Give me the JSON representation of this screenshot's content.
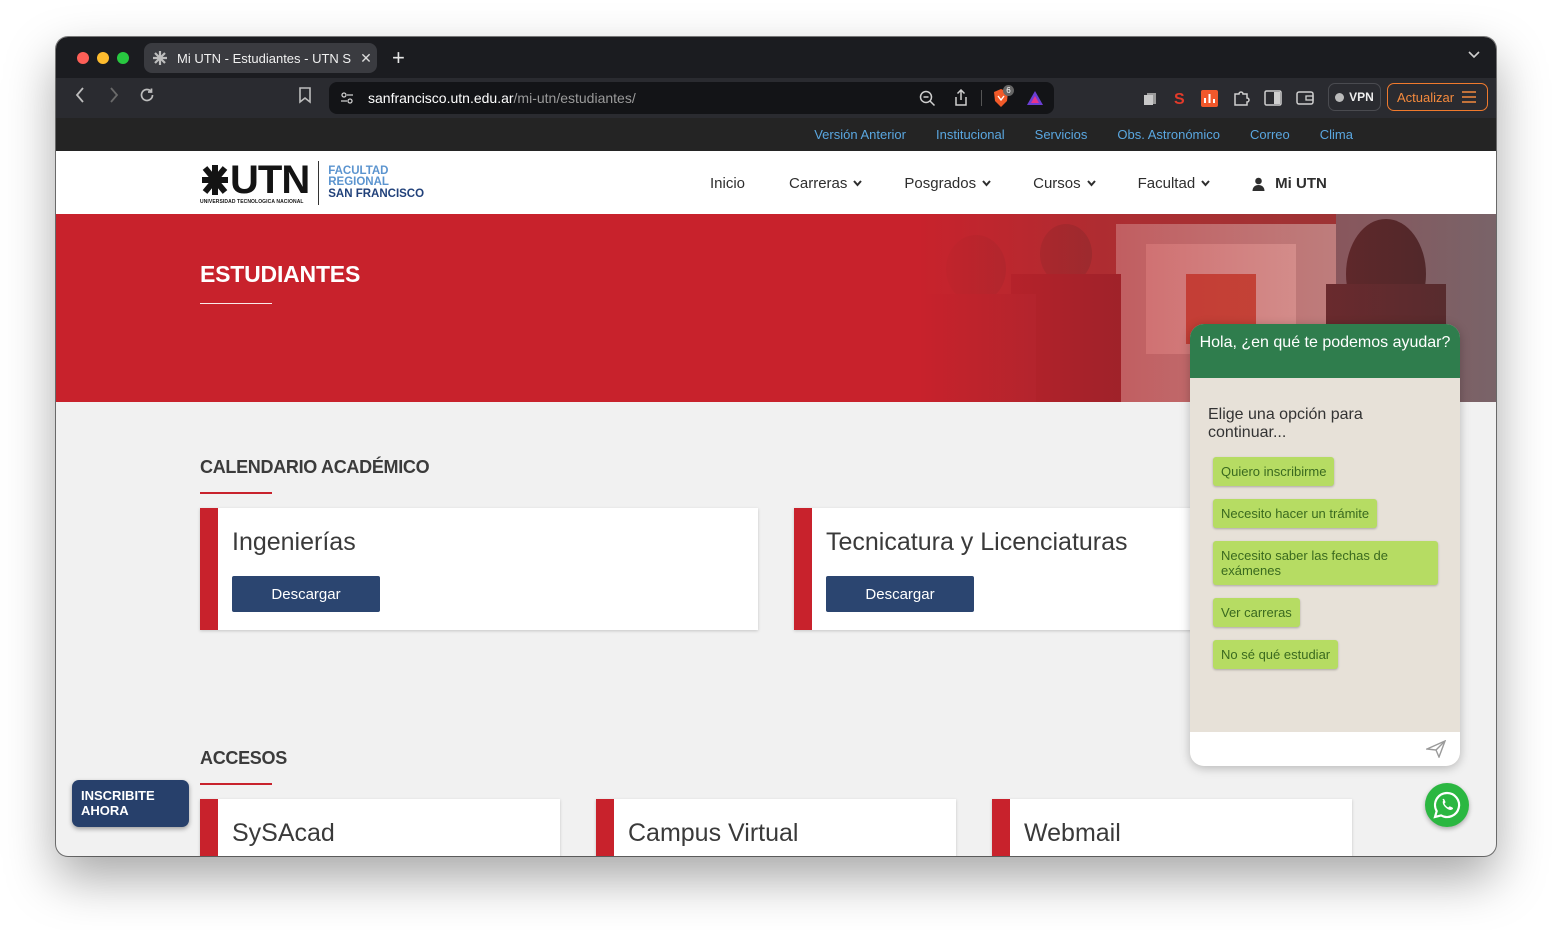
{
  "browser": {
    "tab_title": "Mi UTN - Estudiantes - UTN S",
    "tab_close": "✕",
    "new_tab": "+",
    "tab_menu": "⌄",
    "url_domain": "sanfrancisco.utn.edu.ar",
    "url_path": "/mi-utn/estudiantes/",
    "shield_badge": "6",
    "vpn_label": "VPN",
    "update_label": "Actualizar"
  },
  "topbar": {
    "links": [
      "Versión Anterior",
      "Institucional",
      "Servicios",
      "Obs. Astronómico",
      "Correo",
      "Clima"
    ]
  },
  "header": {
    "logo_text": "UTN",
    "logo_sub": "UNIVERSIDAD TECNOLOGICA NACIONAL",
    "facultad_line1": "FACULTAD",
    "facultad_line2": "REGIONAL",
    "facultad_line3": "SAN FRANCISCO",
    "nav": {
      "inicio": "Inicio",
      "carreras": "Carreras",
      "posgrados": "Posgrados",
      "cursos": "Cursos",
      "facultad": "Facultad",
      "mi_utn": "Mi UTN"
    }
  },
  "hero": {
    "title": "ESTUDIANTES"
  },
  "calendario": {
    "title": "CALENDARIO ACADÉMICO",
    "cards": [
      {
        "title": "Ingenierías",
        "button": "Descargar"
      },
      {
        "title": "Tecnicatura y Licenciaturas",
        "button": "Descargar"
      }
    ]
  },
  "accesos": {
    "title": "ACCESOS",
    "cards": [
      {
        "title": "SySAcad"
      },
      {
        "title": "Campus Virtual"
      },
      {
        "title": "Webmail"
      }
    ]
  },
  "inscribite": {
    "line1": "INSCRIBITE",
    "line2": "AHORA"
  },
  "chat": {
    "header": "Hola, ¿en qué te podemos ayudar?",
    "prompt": "Elige una opción para continuar...",
    "options": [
      "Quiero inscribirme",
      "Necesito hacer un trámite",
      "Necesito saber las fechas de exámenes",
      "Ver carreras",
      "No sé qué estudiar"
    ]
  },
  "colors": {
    "brand_red": "#c8222c",
    "brand_navy": "#2b4570",
    "chat_green": "#2f7d4d",
    "option_green": "#b6dc63",
    "link_blue": "#5aa7e0"
  }
}
